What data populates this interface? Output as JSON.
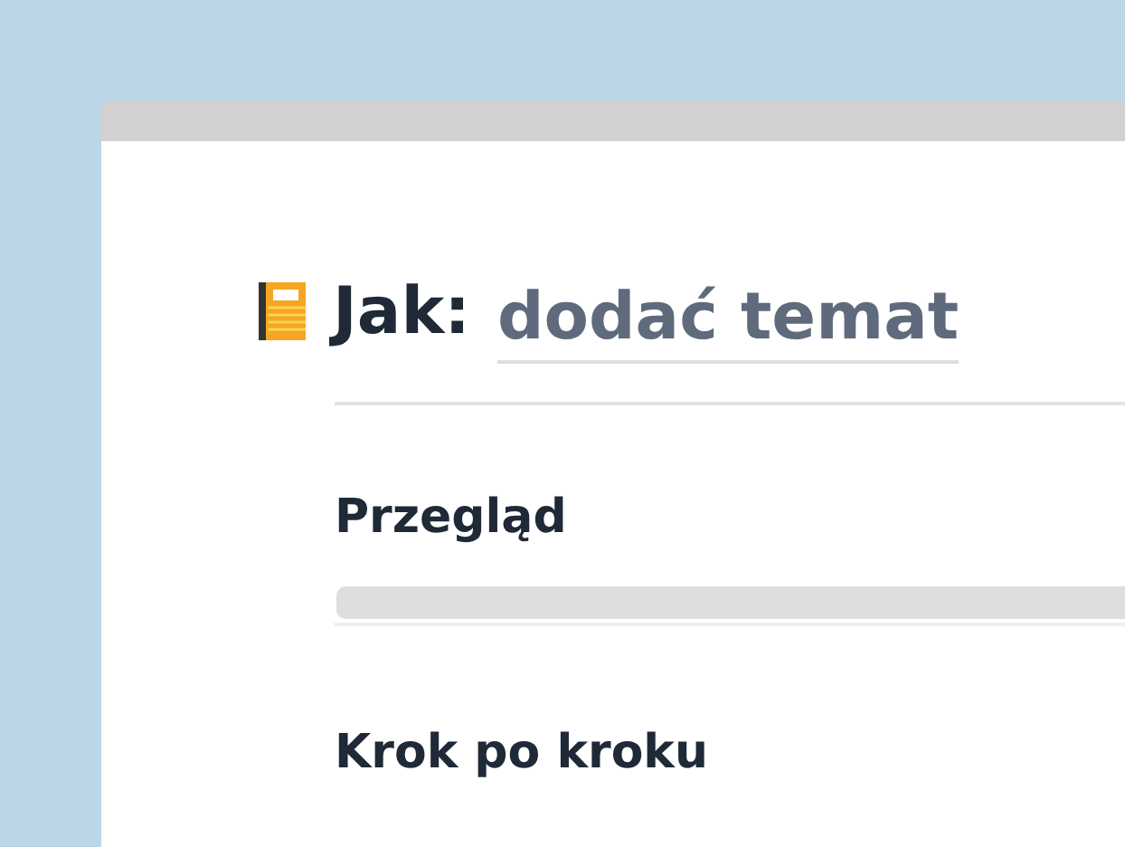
{
  "heading": {
    "prefix": "Jak:",
    "title": "dodać temat"
  },
  "sections": [
    {
      "title": "Przegląd",
      "kind": "placeholder"
    },
    {
      "title": "Krok po kroku",
      "kind": "plain"
    }
  ]
}
